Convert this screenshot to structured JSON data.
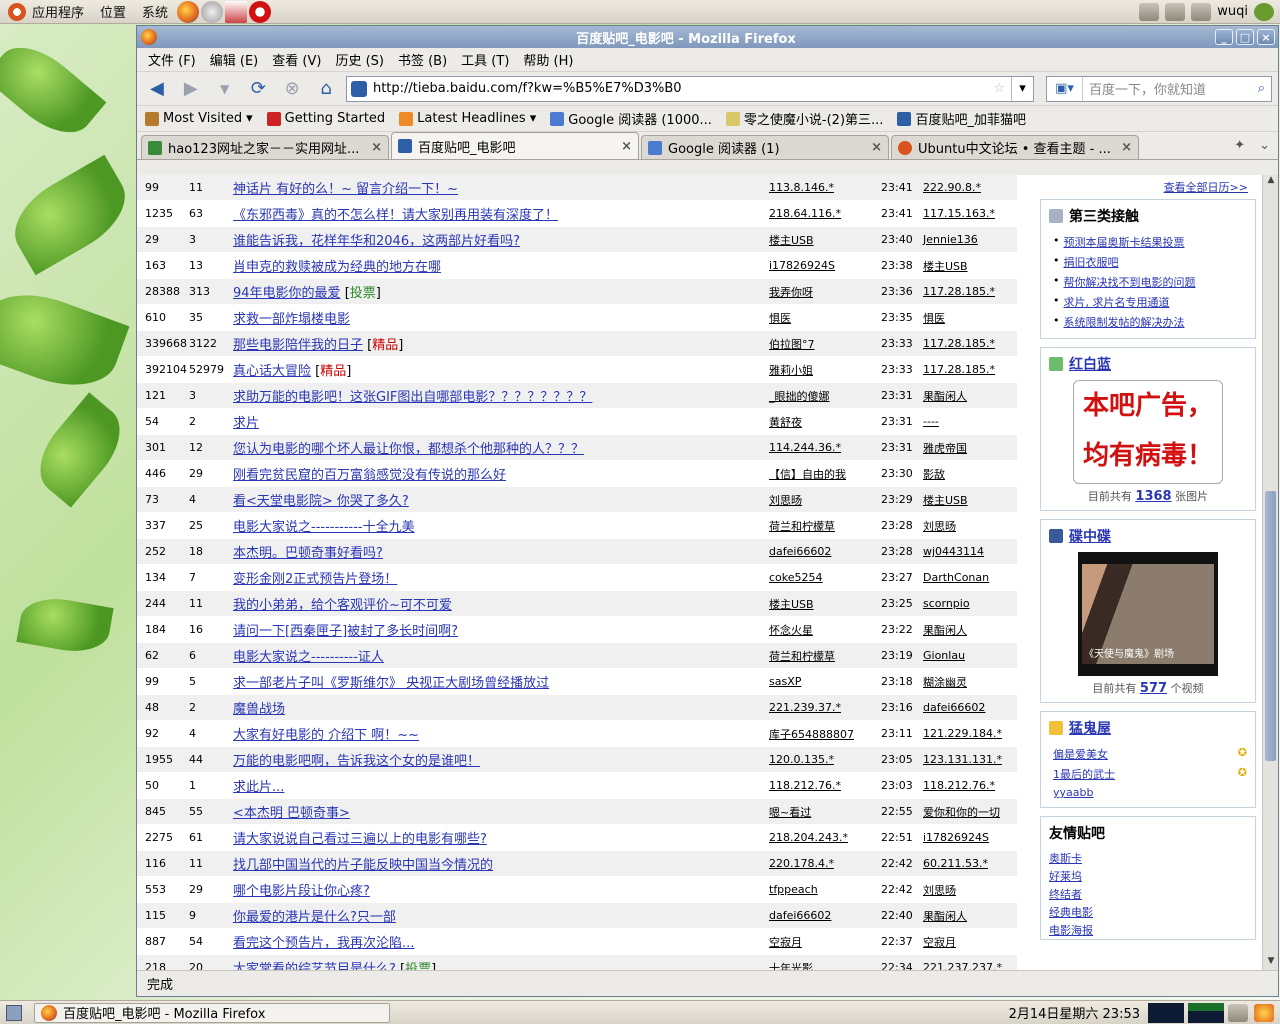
{
  "top_panel": {
    "menus": [
      "应用程序",
      "位置",
      "系统"
    ],
    "user": "wuqi"
  },
  "window": {
    "title": "百度贴吧_电影吧 - Mozilla Firefox",
    "menu": [
      "文件 (F)",
      "编辑 (E)",
      "查看 (V)",
      "历史 (S)",
      "书签 (B)",
      "工具 (T)",
      "帮助 (H)"
    ],
    "url": "http://tieba.baidu.com/f?kw=%B5%E7%D3%B0",
    "search_placeholder": "百度一下，你就知道",
    "bookmarks": [
      "Most Visited",
      "Getting Started",
      "Latest Headlines",
      "Google 阅读器 (1000...",
      "零之使魔小说-(2)第三...",
      "百度贴吧_加菲猫吧"
    ],
    "tabs": [
      {
        "label": "hao123网址之家－－实用网址...",
        "active": false
      },
      {
        "label": "百度贴吧_电影吧",
        "active": true
      },
      {
        "label": "Google 阅读器 (1)",
        "active": false
      },
      {
        "label": "Ubuntu中文论坛 • 查看主题 - ...",
        "active": false
      }
    ],
    "status": "完成"
  },
  "threads": [
    {
      "reply": "99",
      "count": "11",
      "title": "神话片 有好的么！~ 留言介绍一下！~",
      "tag": "",
      "author": "113.8.146.*",
      "time": "23:41",
      "last": "222.90.8.*"
    },
    {
      "reply": "1235",
      "count": "63",
      "title": "《东邪西毒》真的不怎么样！请大家别再用装有深度了！",
      "tag": "",
      "author": "218.64.116.*",
      "time": "23:41",
      "last": "117.15.163.*"
    },
    {
      "reply": "29",
      "count": "3",
      "title": "谁能告诉我，花样年华和2046，这两部片好看吗?",
      "tag": "",
      "author": "楼主USB",
      "time": "23:40",
      "last": "Jennie136"
    },
    {
      "reply": "163",
      "count": "13",
      "title": "肖申克的救赎被成为经典的地方在哪",
      "tag": "",
      "author": "i17826924S",
      "time": "23:38",
      "last": "楼主USB"
    },
    {
      "reply": "28388",
      "count": "313",
      "title": "94年电影你的最爱",
      "tag": "投票",
      "author": "我弄你呀",
      "time": "23:36",
      "last": "117.28.185.*"
    },
    {
      "reply": "610",
      "count": "35",
      "title": "求救一部炸塌楼电影",
      "tag": "",
      "author": "惧医",
      "time": "23:35",
      "last": "惧医"
    },
    {
      "reply": "339668",
      "count": "3122",
      "title": "那些电影陪伴我的日子",
      "tag": "精品",
      "author": "伯拉图°7",
      "time": "23:33",
      "last": "117.28.185.*"
    },
    {
      "reply": "392104",
      "count": "52979",
      "title": "真心话大冒险",
      "tag": "精品",
      "author": "雅莉小姐",
      "time": "23:33",
      "last": "117.28.185.*"
    },
    {
      "reply": "121",
      "count": "3",
      "title": "求助万能的电影吧！这张GIF图出自哪部电影？？？？？？？？",
      "tag": "",
      "author": "_眼拙的傻娜",
      "time": "23:31",
      "last": "果酯闲人"
    },
    {
      "reply": "54",
      "count": "2",
      "title": "求片",
      "tag": "",
      "author": "黄舒夜",
      "time": "23:31",
      "last": "----"
    },
    {
      "reply": "301",
      "count": "12",
      "title": "您认为电影的哪个坏人最让你恨，都想杀个他那种的人？？？",
      "tag": "",
      "author": "114.244.36.*",
      "time": "23:31",
      "last": "雅虎帝国"
    },
    {
      "reply": "446",
      "count": "29",
      "title": "刚看完贫民窟的百万富翁感觉没有传说的那么好",
      "tag": "",
      "author": "【信】自由的我",
      "time": "23:30",
      "last": "影敌"
    },
    {
      "reply": "73",
      "count": "4",
      "title": "看<天堂电影院> 你哭了多久?",
      "tag": "",
      "author": "刘思旸",
      "time": "23:29",
      "last": "楼主USB"
    },
    {
      "reply": "337",
      "count": "25",
      "title": "电影大家说之-----------十全九美",
      "tag": "",
      "author": "荷兰和柠檬草",
      "time": "23:28",
      "last": "刘思旸"
    },
    {
      "reply": "252",
      "count": "18",
      "title": "本杰明。巴顿奇事好看吗?",
      "tag": "",
      "author": "dafei66602",
      "time": "23:28",
      "last": "wj0443114"
    },
    {
      "reply": "134",
      "count": "7",
      "title": "变形金刚2正式预告片登场！",
      "tag": "",
      "author": "coke5254",
      "time": "23:27",
      "last": "DarthConan"
    },
    {
      "reply": "244",
      "count": "11",
      "title": "我的小弟弟，给个客观评价~可不可爱",
      "tag": "",
      "author": "楼主USB",
      "time": "23:25",
      "last": "scornpio"
    },
    {
      "reply": "184",
      "count": "16",
      "title": "请问一下[西秦匣子]被封了多长时间啊?",
      "tag": "",
      "author": "怀念火星",
      "time": "23:22",
      "last": "果酯闲人"
    },
    {
      "reply": "62",
      "count": "6",
      "title": "电影大家说之----------证人",
      "tag": "",
      "author": "荷兰和柠檬草",
      "time": "23:19",
      "last": "Gionlau"
    },
    {
      "reply": "99",
      "count": "5",
      "title": "求一部老片子叫《罗斯维尔》 央视正大剧场曾经播放过",
      "tag": "",
      "author": "sasXP",
      "time": "23:18",
      "last": "糊涂幽灵"
    },
    {
      "reply": "48",
      "count": "2",
      "title": "魔兽战场",
      "tag": "",
      "author": "221.239.37.*",
      "time": "23:16",
      "last": "dafei66602"
    },
    {
      "reply": "92",
      "count": "4",
      "title": "大家有好电影的 介绍下 啊！~~",
      "tag": "",
      "author": "库子654888807",
      "time": "23:11",
      "last": "121.229.184.*"
    },
    {
      "reply": "1955",
      "count": "44",
      "title": "万能的电影吧啊，告诉我这个女的是谁吧！",
      "tag": "",
      "author": "120.0.135.*",
      "time": "23:05",
      "last": "123.131.131.*"
    },
    {
      "reply": "50",
      "count": "1",
      "title": "求此片...",
      "tag": "",
      "author": "118.212.76.*",
      "time": "23:03",
      "last": "118.212.76.*"
    },
    {
      "reply": "845",
      "count": "55",
      "title": "<本杰明 巴顿奇事>",
      "tag": "",
      "author": "嗯~看过",
      "time": "22:55",
      "last": "爱你和你的一切"
    },
    {
      "reply": "2275",
      "count": "61",
      "title": "请大家说说自己看过三遍以上的电影有哪些?",
      "tag": "",
      "author": "218.204.243.*",
      "time": "22:51",
      "last": "i17826924S"
    },
    {
      "reply": "116",
      "count": "11",
      "title": "找几部中国当代的片子能反映中国当今情况的",
      "tag": "",
      "author": "220.178.4.*",
      "time": "22:42",
      "last": "60.211.53.*"
    },
    {
      "reply": "553",
      "count": "29",
      "title": "哪个电影片段让你心疼?",
      "tag": "",
      "author": "tfppeach",
      "time": "22:42",
      "last": "刘思旸"
    },
    {
      "reply": "115",
      "count": "9",
      "title": "你最爱的港片是什么?只一部",
      "tag": "",
      "author": "dafei66602",
      "time": "22:40",
      "last": "果酯闲人"
    },
    {
      "reply": "887",
      "count": "54",
      "title": "看完这个预告片，我再次沦陷...",
      "tag": "",
      "author": "空寂月",
      "time": "22:37",
      "last": "空寂月"
    },
    {
      "reply": "218",
      "count": "20",
      "title": "大家常看的综艺节目是什么?",
      "tag": "投票",
      "author": "十年光影",
      "time": "22:34",
      "last": "221.237.237.*"
    }
  ],
  "sidebar": {
    "more_link": "查看全部日历>>",
    "third_title": "第三类接触",
    "third_items": [
      "预测本届奥斯卡结果投票",
      "捐旧衣服吧",
      "帮你解决找不到电影的问题",
      "求片, 求片名专用通道",
      "系统限制发帖的解决办法"
    ],
    "image_box_title": "红白蓝",
    "image_box_ad": "本吧广告，均有病毒！",
    "image_count_prefix": "目前共有",
    "image_count": "1368",
    "image_count_suffix": "张图片",
    "video_box_title": "碟中碟",
    "video_caption": "《天使与魔鬼》剧场",
    "video_count_prefix": "目前共有",
    "video_count": "577",
    "video_count_suffix": "个视频",
    "ghost_title": "猛鬼屋",
    "ghost_items": [
      "偏是爱美女",
      "1最后的武士",
      "yyaabb"
    ],
    "friends_title": "友情贴吧",
    "friends": [
      "奥斯卡",
      "好莱坞",
      "终结者",
      "经典电影",
      "电影海报"
    ]
  },
  "taskbar": {
    "task_label": "百度贴吧_电影吧 - Mozilla Firefox",
    "clock": "2月14日星期六 23:53"
  }
}
